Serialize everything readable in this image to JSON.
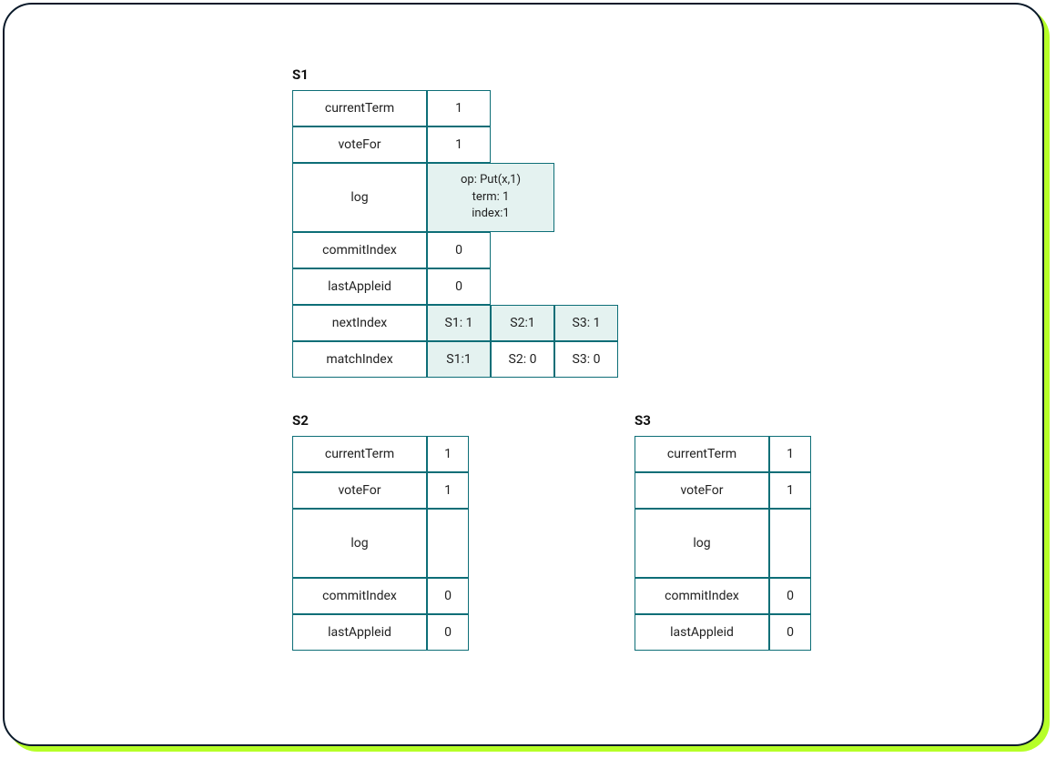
{
  "servers": {
    "s1": {
      "title": "S1",
      "rows": {
        "currentTerm": {
          "label": "currentTerm",
          "value": "1"
        },
        "voteFor": {
          "label": "voteFor",
          "value": "1"
        },
        "log": {
          "label": "log",
          "entry": {
            "op": "op: Put(x,1)",
            "term": "term: 1",
            "index": "index:1"
          }
        },
        "commitIndex": {
          "label": "commitIndex",
          "value": "0"
        },
        "lastAppleid": {
          "label": "lastAppleid",
          "value": "0"
        },
        "nextIndex": {
          "label": "nextIndex",
          "cells": [
            "S1: 1",
            "S2:1",
            "S3: 1"
          ]
        },
        "matchIndex": {
          "label": "matchIndex",
          "cells": [
            "S1:1",
            "S2: 0",
            "S3: 0"
          ]
        }
      }
    },
    "s2": {
      "title": "S2",
      "rows": {
        "currentTerm": {
          "label": "currentTerm",
          "value": "1"
        },
        "voteFor": {
          "label": "voteFor",
          "value": "1"
        },
        "log": {
          "label": "log"
        },
        "commitIndex": {
          "label": "commitIndex",
          "value": "0"
        },
        "lastAppleid": {
          "label": "lastAppleid",
          "value": "0"
        }
      }
    },
    "s3": {
      "title": "S3",
      "rows": {
        "currentTerm": {
          "label": "currentTerm",
          "value": "1"
        },
        "voteFor": {
          "label": "voteFor",
          "value": "1"
        },
        "log": {
          "label": "log"
        },
        "commitIndex": {
          "label": "commitIndex",
          "value": "0"
        },
        "lastAppleid": {
          "label": "lastAppleid",
          "value": "0"
        }
      }
    }
  }
}
